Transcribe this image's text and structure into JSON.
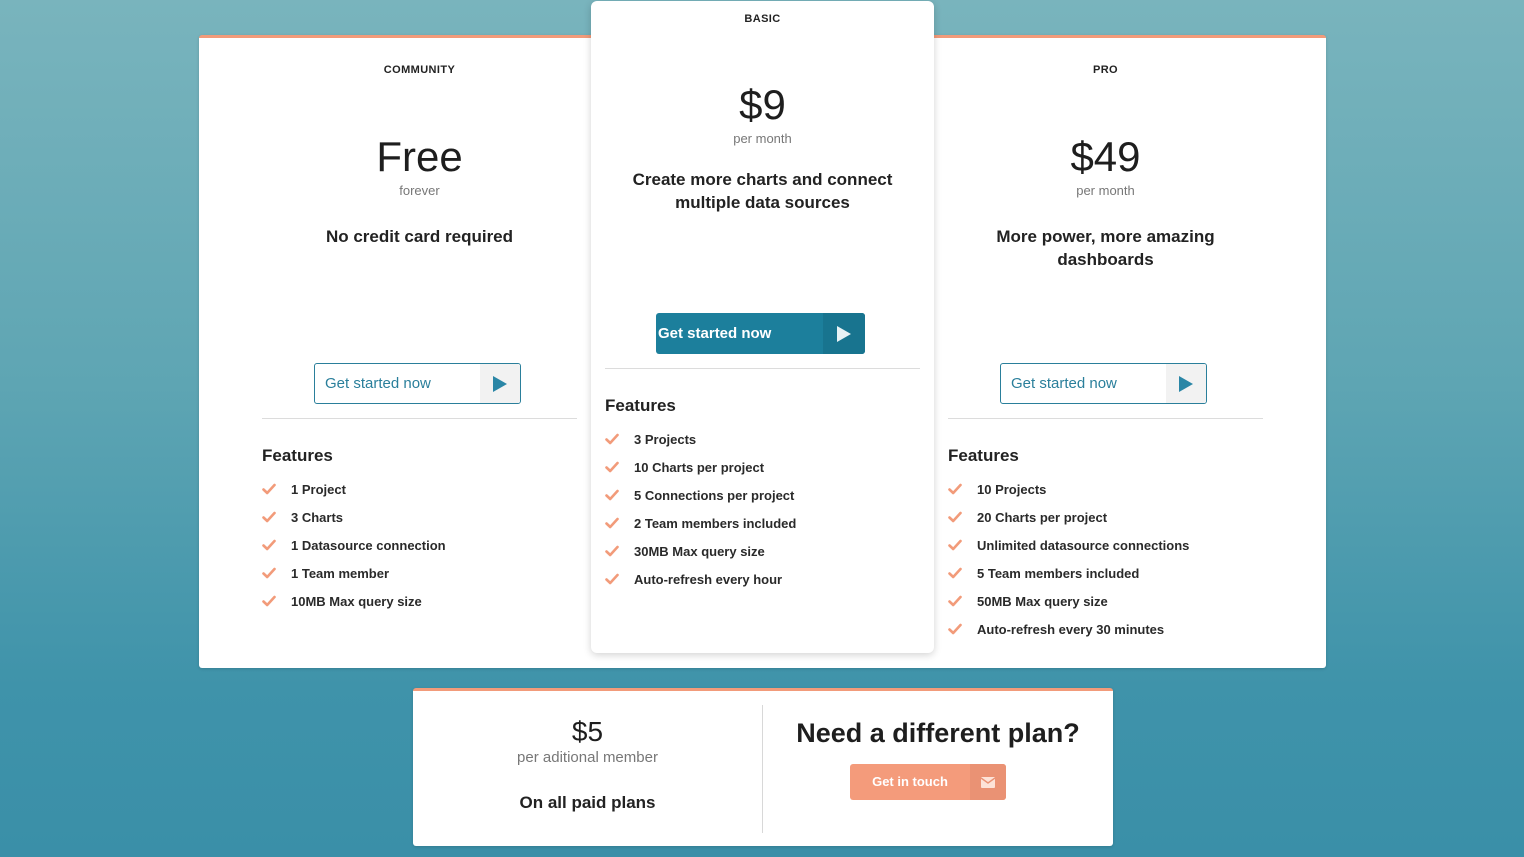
{
  "colors": {
    "accent_orange": "#f29b7a",
    "primary_teal": "#1c7f9c",
    "check_color": "#f29b7a"
  },
  "plans": [
    {
      "name": "COMMUNITY",
      "price": "Free",
      "period": "forever",
      "tagline": "No credit card required",
      "cta_label": "Get started now",
      "cta_icon": "play-icon",
      "features_title": "Features",
      "features": [
        "1 Project",
        "3 Charts",
        "1 Datasource connection",
        "1 Team member",
        "10MB Max query size"
      ]
    },
    {
      "name": "BASIC",
      "price": "$9",
      "period": "per month",
      "tagline": "Create more charts and connect multiple data sources",
      "cta_label": "Get started now",
      "cta_icon": "play-icon",
      "features_title": "Features",
      "features": [
        "3 Projects",
        "10 Charts per project",
        "5 Connections per project",
        "2 Team members included",
        "30MB Max query size",
        "Auto-refresh every hour"
      ]
    },
    {
      "name": "PRO",
      "price": "$49",
      "period": "per month",
      "tagline": "More power, more amazing dashboards",
      "cta_label": "Get started now",
      "cta_icon": "play-icon",
      "features_title": "Features",
      "features": [
        "10 Projects",
        "20 Charts per project",
        "Unlimited datasource connections",
        "5 Team members included",
        "50MB Max query size",
        "Auto-refresh every 30 minutes"
      ]
    }
  ],
  "extra": {
    "price": "$5",
    "period": "per aditional member",
    "note": "On all paid plans",
    "different_plan_title": "Need a different plan?",
    "contact_label": "Get in touch",
    "contact_icon": "envelope-icon"
  }
}
